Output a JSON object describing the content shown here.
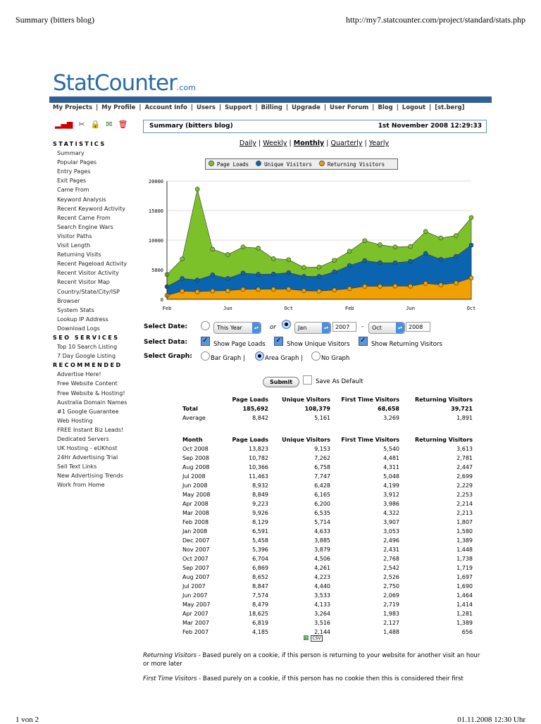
{
  "browser": {
    "page_title": "Summary (bitters blog)",
    "url": "http://my7.statcounter.com/project/standard/stats.php",
    "footer_left": "1 von 2",
    "footer_right": "01.11.2008 12:30 Uhr"
  },
  "logo": {
    "text": "StatCounter",
    "suffix": ".com"
  },
  "nav": [
    "My Projects",
    "My Profile",
    "Account Info",
    "Users",
    "Support",
    "Billing",
    "Upgrade",
    "User Forum",
    "Blog",
    "Logout",
    "[st.berg]"
  ],
  "toolbar_icons": [
    "bar-chart-icon",
    "scissors-icon",
    "lock-icon",
    "envelope-icon",
    "trash-icon"
  ],
  "summary": {
    "title": "Summary (bitters blog)",
    "datetime": "1st November 2008 12:29:33"
  },
  "sidebar": {
    "sections": [
      {
        "heading": "STATISTICS",
        "items": [
          "Summary",
          "Popular Pages",
          "Entry Pages",
          "Exit Pages",
          "Came From",
          "Keyword Analysis",
          "Recent Keyword Activity",
          "Recent Came From",
          "Search Engine Wars",
          "Visitor Paths",
          "Visit Length",
          "Returning Visits",
          "Recent Pageload Activity",
          "Recent Visitor Activity",
          "Recent Visitor Map",
          "Country/State/City/ISP",
          "Browser",
          "System Stats",
          "Lookup IP Address",
          "Download Logs"
        ]
      },
      {
        "heading": "SEO SERVICES",
        "items": [
          "Top 10 Search Listing",
          "7 Day Google Listing"
        ]
      },
      {
        "heading": "RECOMMENDED",
        "items": [
          "Advertise Here!",
          "Free Website Content",
          "Free Website & Hosting!",
          "Australia Domain Names",
          "#1 Google Guarantee",
          "Web Hosting",
          "FREE Instant Biz Leads!",
          "Dedicated Servers",
          "UK Hosting - eUKhost",
          "24Hr Advertising Trial",
          "Sell Text Links",
          "New Advertising Trends",
          "Work from Home"
        ]
      }
    ]
  },
  "periods": {
    "items": [
      "Daily",
      "Weekly",
      "Monthly",
      "Quarterly",
      "Yearly"
    ],
    "selected": "Monthly"
  },
  "chart_data": {
    "type": "area",
    "x": [
      "Feb 2007",
      "Mar 2007",
      "Apr 2007",
      "May 2007",
      "Jun 2007",
      "Jul 2007",
      "Aug 2007",
      "Sep 2007",
      "Oct 2007",
      "Nov 2007",
      "Dec 2007",
      "Jan 2008",
      "Feb 2008",
      "Mar 2008",
      "Apr 2008",
      "May 2008",
      "Jun 2008",
      "Jul 2008",
      "Aug 2008",
      "Sep 2008",
      "Oct 2008"
    ],
    "xticks": [
      "Feb",
      "Jun",
      "Oct",
      "Feb",
      "Jun",
      "Oct"
    ],
    "yticks": [
      "0",
      "5000",
      "10000",
      "15000",
      "20000"
    ],
    "ylim": [
      0,
      20000
    ],
    "grid": true,
    "legend": "top",
    "series": [
      {
        "name": "Page Loads",
        "color": "#7dc12a",
        "values": [
          4185,
          6819,
          18625,
          8479,
          7574,
          8847,
          8652,
          6869,
          6704,
          5396,
          5458,
          6591,
          8129,
          9926,
          9223,
          8849,
          8932,
          11463,
          10366,
          10782,
          13823
        ]
      },
      {
        "name": "Unique Visitors",
        "color": "#0b64b0",
        "values": [
          2144,
          3516,
          3264,
          4133,
          3533,
          4440,
          4223,
          4261,
          4506,
          3879,
          3885,
          4633,
          5714,
          6535,
          6200,
          6165,
          6428,
          7747,
          6758,
          7262,
          9153
        ]
      },
      {
        "name": "Returning Visitors",
        "color": "#f0a000",
        "values": [
          656,
          1389,
          1281,
          1414,
          1464,
          1690,
          1697,
          1719,
          1738,
          1448,
          1389,
          1580,
          1807,
          2213,
          2214,
          2253,
          2229,
          2699,
          2447,
          2781,
          3613
        ]
      }
    ]
  },
  "form": {
    "select_date_label": "Select Date:",
    "this_year": "This Year",
    "or": "or",
    "from_month": "Jan",
    "from_year": "2007",
    "dash": "-",
    "to_month": "Oct",
    "to_year": "2008",
    "select_data_label": "Select Data:",
    "show_page_loads": "Show Page Loads",
    "show_unique": "Show Unique Visitors",
    "show_returning": "Show Returning Visitors",
    "select_graph_label": "Select Graph:",
    "bar_graph": "Bar Graph |",
    "area_graph": "Area Graph |",
    "no_graph": "No Graph",
    "submit": "Submit",
    "save_default": "Save As Default"
  },
  "totals": {
    "headers": [
      "",
      "Page Loads",
      "Unique Visitors",
      "First Time Visitors",
      "Returning Visitors"
    ],
    "rows": [
      [
        "Total",
        "185,692",
        "108,379",
        "68,658",
        "39,721"
      ],
      [
        "Average",
        "8,842",
        "5,161",
        "3,269",
        "1,891"
      ]
    ]
  },
  "monthly": {
    "headers": [
      "Month",
      "Page Loads",
      "Unique Visitors",
      "First Time Visitors",
      "Returning Visitors"
    ],
    "rows": [
      [
        "Oct 2008",
        "13,823",
        "9,153",
        "5,540",
        "3,613"
      ],
      [
        "Sep 2008",
        "10,782",
        "7,262",
        "4,481",
        "2,781"
      ],
      [
        "Aug 2008",
        "10,366",
        "6,758",
        "4,311",
        "2,447"
      ],
      [
        "Jul 2008",
        "11,463",
        "7,747",
        "5,048",
        "2,699"
      ],
      [
        "Jun 2008",
        "8,932",
        "6,428",
        "4,199",
        "2,229"
      ],
      [
        "May 2008",
        "8,849",
        "6,165",
        "3,912",
        "2,253"
      ],
      [
        "Apr 2008",
        "9,223",
        "6,200",
        "3,986",
        "2,214"
      ],
      [
        "Mar 2008",
        "9,926",
        "6,535",
        "4,322",
        "2,213"
      ],
      [
        "Feb 2008",
        "8,129",
        "5,714",
        "3,907",
        "1,807"
      ],
      [
        "Jan 2008",
        "6,591",
        "4,633",
        "3,053",
        "1,580"
      ],
      [
        "Dec 2007",
        "5,458",
        "3,885",
        "2,496",
        "1,389"
      ],
      [
        "Nov 2007",
        "5,396",
        "3,879",
        "2,431",
        "1,448"
      ],
      [
        "Oct 2007",
        "6,704",
        "4,506",
        "2,768",
        "1,738"
      ],
      [
        "Sep 2007",
        "6,869",
        "4,261",
        "2,542",
        "1,719"
      ],
      [
        "Aug 2007",
        "8,652",
        "4,223",
        "2,526",
        "1,697"
      ],
      [
        "Jul 2007",
        "8,847",
        "4,440",
        "2,750",
        "1,690"
      ],
      [
        "Jun 2007",
        "7,574",
        "3,533",
        "2,069",
        "1,464"
      ],
      [
        "May 2007",
        "8,479",
        "4,133",
        "2,719",
        "1,414"
      ],
      [
        "Apr 2007",
        "18,625",
        "3,264",
        "1,983",
        "1,281"
      ],
      [
        "Mar 2007",
        "6,819",
        "3,516",
        "2,127",
        "1,389"
      ],
      [
        "Feb 2007",
        "4,185",
        "2,144",
        "1,488",
        "656"
      ]
    ]
  },
  "export_icons": [
    "excel-icon",
    "csv-icon"
  ],
  "notes": [
    {
      "term": "Returning Visitors",
      "text": " - Based purely on a cookie, if this person is returning to your website for another visit an hour or more later"
    },
    {
      "term": "First Time Visitors",
      "text": " - Based purely on a cookie, if this person has no cookie then this is considered their first"
    }
  ]
}
